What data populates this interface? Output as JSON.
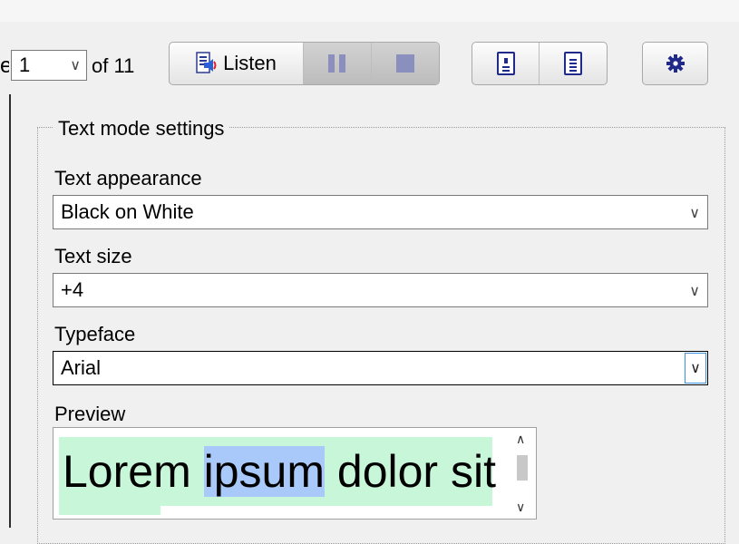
{
  "toolbar": {
    "page_edge_char": "e",
    "page_select_value": "1",
    "of_label": "of 11",
    "listen_label": "Listen"
  },
  "icons": {
    "speaker": "speaker-icon",
    "pause": "pause-icon",
    "stop": "stop-icon",
    "page_view": "page-view-icon",
    "text_view": "text-view-icon",
    "settings": "gear-icon",
    "dropdown": "chevron-down-icon"
  },
  "panel": {
    "title": "Text mode settings",
    "appearance_label": "Text appearance",
    "appearance_value": "Black on White",
    "size_label": "Text size",
    "size_value": "+4",
    "typeface_label": "Typeface",
    "typeface_value": "Arial",
    "preview_label": "Preview",
    "preview_words": {
      "before": "Lorem ",
      "highlighted": "ipsum",
      "after": " dolor sit"
    }
  },
  "colors": {
    "preview_bg": "#c7f7d8",
    "preview_highlight": "#a9c9fb",
    "control_icon": "#8a8fbd",
    "accent_icon": "#1f2a8a",
    "focus_border": "#3c8ede"
  }
}
